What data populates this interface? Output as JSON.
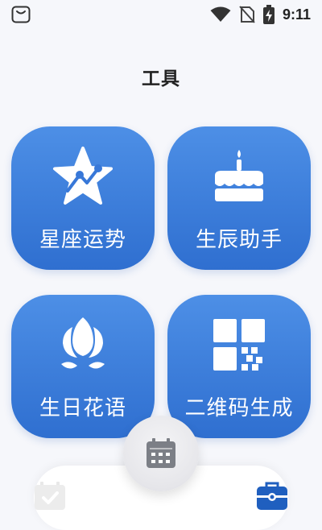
{
  "status_bar": {
    "time": "9:11",
    "icons": [
      "app-notification-icon",
      "wifi-icon",
      "no-sim-icon",
      "battery-charging-icon"
    ]
  },
  "page": {
    "title": "工具"
  },
  "tools": [
    {
      "label": "星座运势",
      "icon": "star-chart-icon"
    },
    {
      "label": "生辰助手",
      "icon": "birthday-cake-icon"
    },
    {
      "label": "生日花语",
      "icon": "lotus-flower-icon"
    },
    {
      "label": "二维码生成",
      "icon": "qr-code-icon"
    }
  ],
  "bottom_nav": {
    "left_icon": "calendar-check-icon",
    "center_icon": "calendar-icon",
    "right_icon": "toolbox-icon"
  },
  "colors": {
    "tile_gradient_top": "#4d8fe6",
    "tile_gradient_bottom": "#2f6fd0",
    "active_nav": "#1f5fbf",
    "inactive_nav": "#ececec",
    "background": "#f6f7fb"
  }
}
